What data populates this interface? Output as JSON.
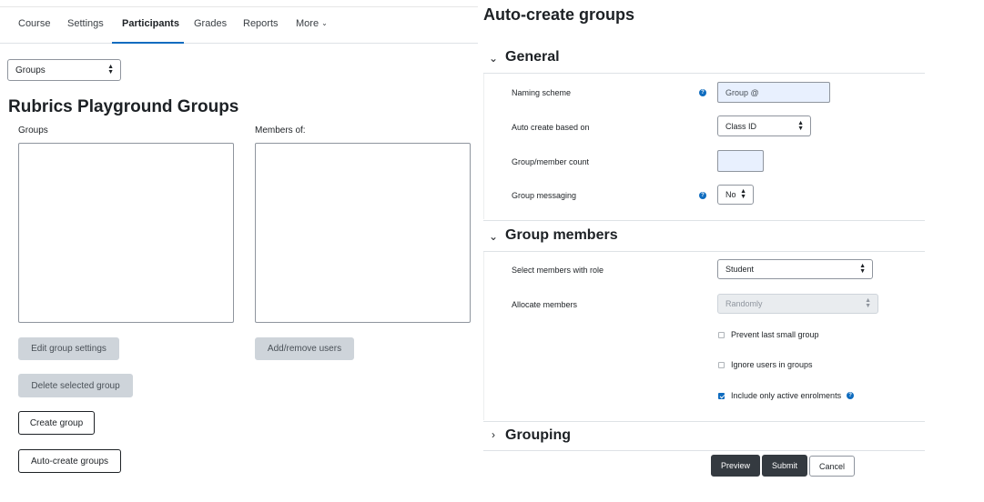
{
  "nav": {
    "tabs": [
      "Course",
      "Settings",
      "Participants",
      "Grades",
      "Reports",
      "More"
    ],
    "active": "Participants"
  },
  "page_select": {
    "value": "Groups"
  },
  "left": {
    "title": "Rubrics Playground Groups",
    "groups_label": "Groups",
    "members_label": "Members of:",
    "buttons": {
      "edit_group_settings": "Edit group settings",
      "add_remove_users": "Add/remove users",
      "delete_selected_group": "Delete selected group",
      "create_group": "Create group",
      "auto_create_groups": "Auto-create groups"
    }
  },
  "right": {
    "title": "Auto-create groups",
    "general": {
      "heading": "General",
      "naming_scheme_label": "Naming scheme",
      "naming_scheme_value": "Group @",
      "auto_create_label": "Auto create based on",
      "auto_create_value": "Class ID",
      "count_label": "Group/member count",
      "count_value": "",
      "messaging_label": "Group messaging",
      "messaging_value": "No"
    },
    "members": {
      "heading": "Group members",
      "role_label": "Select members with role",
      "role_value": "Student",
      "allocate_label": "Allocate members",
      "allocate_value": "Randomly",
      "prevent_small": "Prevent last small group",
      "ignore_users": "Ignore users in groups",
      "active_only": "Include only active enrolments"
    },
    "grouping": {
      "heading": "Grouping"
    },
    "actions": {
      "preview": "Preview",
      "submit": "Submit",
      "cancel": "Cancel"
    }
  },
  "colors": {
    "accent": "#0f6cbf",
    "dark_button": "#343a40",
    "disabled_button": "#ced4da"
  }
}
